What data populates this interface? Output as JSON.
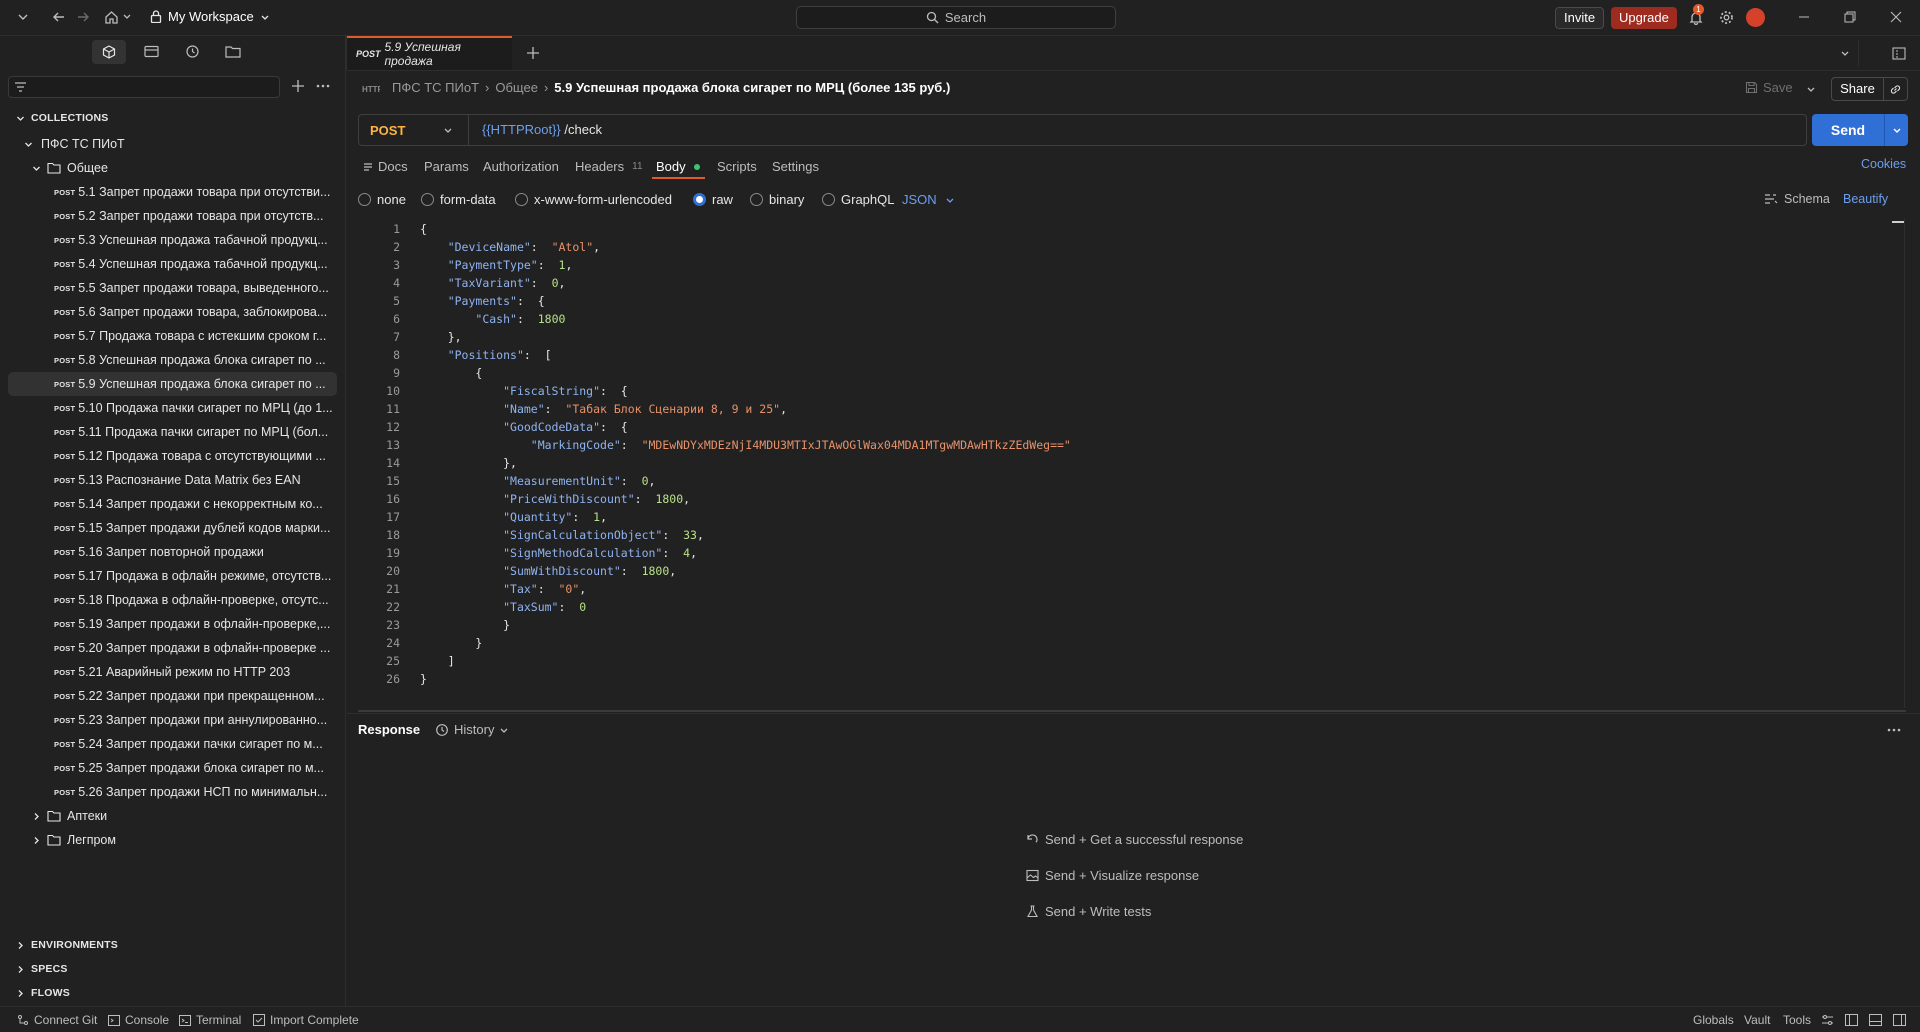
{
  "topbar": {
    "workspace": "My Workspace",
    "search_placeholder": "Search",
    "invite": "Invite",
    "upgrade": "Upgrade",
    "notification_count": "1"
  },
  "sidebar": {
    "collections_label": "COLLECTIONS",
    "collection_name": "ПФС ТС ПИоТ",
    "folder_open": "Общее",
    "method_tag": "POST",
    "requests": [
      "5.1 Запрет продажи товара при отсутстви...",
      "5.2 Запрет продажи товара при отсутств...",
      "5.3 Успешная продажа табачной продукц...",
      "5.4 Успешная продажа табачной продукц...",
      "5.5 Запрет продажи товара, выведенного...",
      "5.6 Запрет продажи товара, заблокирова...",
      "5.7 Продажа товара с истекшим сроком г...",
      "5.8 Успешная продажа блока сигарет по ...",
      "5.9 Успешная продажа блока сигарет по ...",
      "5.10 Продажа пачки сигарет по МРЦ (до 1...",
      "5.11 Продажа пачки сигарет по МРЦ (бол...",
      "5.12 Продажа товара с отсутствующими ...",
      "5.13 Распознание Data Matrix без EAN",
      "5.14 Запрет продажи с некорректным ко...",
      "5.15 Запрет продажи дублей кодов марки...",
      "5.16 Запрет повторной продажи",
      "5.17 Продажа в офлайн режиме, отсутств...",
      "5.18 Продажа в офлайн-проверке, отсутс...",
      "5.19 Запрет продажи в офлайн-проверке,...",
      "5.20 Запрет продажи в офлайн-проверке ...",
      "5.21 Аварийный режим по HTTP 203",
      "5.22 Запрет продажи при прекращенном...",
      "5.23 Запрет продажи при аннулированно...",
      "5.24 Запрет продажи пачки сигарет по м...",
      "5.25 Запрет продажи блока сигарет по м...",
      "5.26 Запрет продажи НСП по минимальн..."
    ],
    "folders_closed": [
      "Аптеки",
      "Легпром"
    ],
    "bottom_sections": [
      "ENVIRONMENTS",
      "SPECS",
      "FLOWS"
    ]
  },
  "tab": {
    "method": "POST",
    "title": "5.9 Успешная продажа"
  },
  "request": {
    "breadcrumb_collection": "ПФС ТС ПИоТ",
    "breadcrumb_folder": "Общее",
    "breadcrumb_title": "5.9 Успешная продажа блока сигарет по МРЦ (более 135 руб.)",
    "save": "Save",
    "share": "Share",
    "method": "POST",
    "url_var": "{{HTTPRoot}}",
    "url_path": " /check",
    "send": "Send",
    "tabs": {
      "docs": "Docs",
      "params": "Params",
      "authorization": "Authorization",
      "headers": "Headers",
      "headers_count": "11",
      "body": "Body",
      "scripts": "Scripts",
      "settings": "Settings",
      "cookies": "Cookies"
    },
    "body_modes": {
      "none": "none",
      "form_data": "form-data",
      "urlencoded": "x-www-form-urlencoded",
      "raw": "raw",
      "binary": "binary",
      "graphql": "GraphQL",
      "format": "JSON",
      "schema": "Schema",
      "beautify": "Beautify"
    }
  },
  "code_lines": [
    "1",
    "2",
    "3",
    "4",
    "5",
    "6",
    "7",
    "8",
    "9",
    "10",
    "11",
    "12",
    "13",
    "14",
    "15",
    "16",
    "17",
    "18",
    "19",
    "20",
    "21",
    "22",
    "23",
    "24",
    "25",
    "26"
  ],
  "code": {
    "device_key": "\"DeviceName\"",
    "device_val": "\"Atol\"",
    "ptype_key": "\"PaymentType\"",
    "ptype_val": "1",
    "tax_key": "\"TaxVariant\"",
    "tax_val": "0",
    "payments_key": "\"Payments\"",
    "cash_key": "\"Cash\"",
    "cash_val": "1800",
    "positions_key": "\"Positions\"",
    "fiscal_key": "\"FiscalString\"",
    "name_key": "\"Name\"",
    "name_val": "\"Табак Блок Сценарии 8, 9 и 25\"",
    "gcd_key": "\"GoodCodeData\"",
    "mcode_key": "\"MarkingCode\"",
    "mcode_val": "\"MDEwNDYxMDEzNjI4MDU3MTIxJTAwOGlWax04MDA1MTgwMDAwHTkzZEdWeg==\"",
    "mu_key": "\"MeasurementUnit\"",
    "mu_val": "0",
    "pwd_key": "\"PriceWithDiscount\"",
    "pwd_val": "1800",
    "qty_key": "\"Quantity\"",
    "qty_val": "1",
    "sco_key": "\"SignCalculationObject\"",
    "sco_val": "33",
    "smc_key": "\"SignMethodCalculation\"",
    "smc_val": "4",
    "swd_key": "\"SumWithDiscount\"",
    "swd_val": "1800",
    "taxp_key": "\"Tax\"",
    "taxp_val": "\"0\"",
    "taxsum_key": "\"TaxSum\"",
    "taxsum_val": "0"
  },
  "response": {
    "label": "Response",
    "history": "History",
    "hint1": "Send + Get a successful response",
    "hint2": "Send + Visualize response",
    "hint3": "Send + Write tests"
  },
  "footer": {
    "connect_git": "Connect Git",
    "console": "Console",
    "terminal": "Terminal",
    "import": "Import Complete",
    "globals": "Globals",
    "vault": "Vault",
    "tools": "Tools"
  },
  "colors": {
    "accent_orange": "#e05a2b",
    "send_blue": "#2f6fd6",
    "method_post": "#ffb341",
    "json_key": "#8fb3f0",
    "json_string": "#e7926a",
    "json_number": "#b7e08a"
  }
}
